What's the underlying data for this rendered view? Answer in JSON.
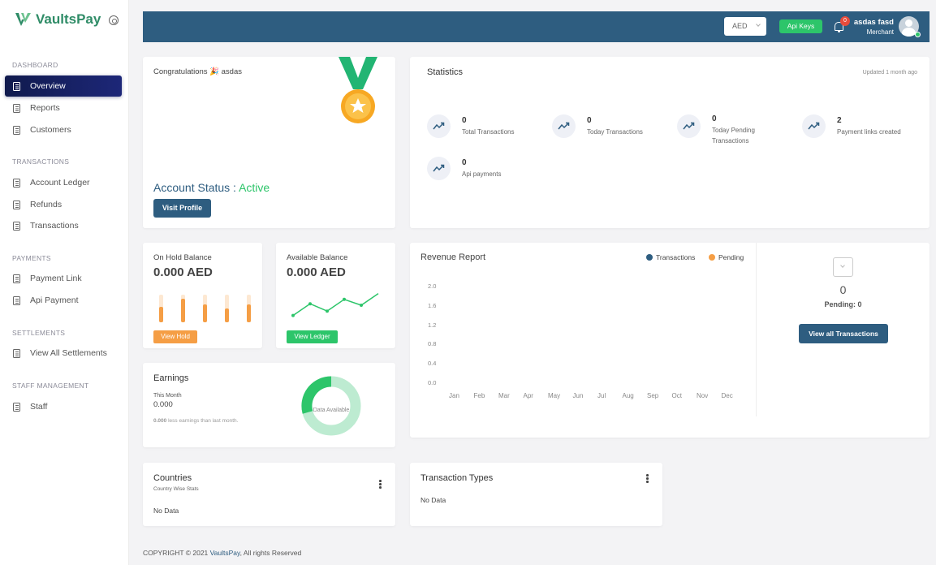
{
  "sidebar": {
    "logo_text": "VaultsPay",
    "sections": [
      {
        "title": "DASHBOARD",
        "items": [
          "Overview",
          "Reports",
          "Customers"
        ]
      },
      {
        "title": "TRANSACTIONS",
        "items": [
          "Account Ledger",
          "Refunds",
          "Transactions"
        ]
      },
      {
        "title": "PAYMENTS",
        "items": [
          "Payment Link",
          "Api Payment"
        ]
      },
      {
        "title": "SETTLEMENTS",
        "items": [
          "View All Settlements"
        ]
      },
      {
        "title": "STAFF MANAGEMENT",
        "items": [
          "Staff"
        ]
      }
    ],
    "active_item": "Overview"
  },
  "header": {
    "currency": "AED",
    "api_keys_label": "Api Keys",
    "notification_count": "0",
    "user_name": "asdas fasd",
    "user_role": "Merchant"
  },
  "welcome": {
    "greeting": "Congratulations 🎉 asdas",
    "status_label": "Account Status : ",
    "status_value": "Active",
    "visit_profile_label": "Visit Profile"
  },
  "statistics": {
    "title": "Statistics",
    "updated": "Updated 1 month ago",
    "items": [
      {
        "value": "0",
        "label_lines": [
          "Total Transactions"
        ]
      },
      {
        "value": "0",
        "label_lines": [
          "Today Transactions"
        ]
      },
      {
        "value": "0",
        "label_lines": [
          "Today Pending",
          "Transactions"
        ]
      },
      {
        "value": "2",
        "label_lines": [
          "Payment links created"
        ]
      },
      {
        "value": "0",
        "label_lines": [
          "Api payments"
        ]
      }
    ]
  },
  "on_hold": {
    "title": "On Hold Balance",
    "amount": "0.000 AED",
    "button": "View Hold",
    "bar_fills": [
      0.55,
      0.85,
      0.65,
      0.5,
      0.65
    ]
  },
  "available": {
    "title": "Available Balance",
    "amount": "0.000 AED",
    "button": "View Ledger",
    "trend": [
      0.15,
      0.55,
      0.3,
      0.7,
      0.5,
      0.9
    ]
  },
  "earnings": {
    "title": "Earnings",
    "period": "This Month",
    "value": "0.000",
    "comparison_value": "0.000",
    "comparison_text": "less earnings than last month.",
    "donut_label": "Data Available"
  },
  "revenue": {
    "title": "Revenue Report",
    "legend": [
      {
        "name": "Transactions",
        "color": "#2e5d80"
      },
      {
        "name": "Pending",
        "color": "#f59e45"
      }
    ],
    "side_value": "0",
    "pending_label": "Pending: 0",
    "view_all_label": "View all Transactions"
  },
  "chart_data": {
    "type": "bar",
    "categories": [
      "Jan",
      "Feb",
      "Mar",
      "Apr",
      "May",
      "Jun",
      "Jul",
      "Aug",
      "Sep",
      "Oct",
      "Nov",
      "Dec"
    ],
    "series": [
      {
        "name": "Transactions",
        "values": [
          0,
          0,
          0,
          0,
          0,
          0,
          0,
          0,
          0,
          0,
          0,
          0
        ]
      },
      {
        "name": "Pending",
        "values": [
          0,
          0,
          0,
          0,
          0,
          0,
          0,
          0,
          0,
          0,
          0,
          0
        ]
      }
    ],
    "yticks": [
      "2.0",
      "1.6",
      "1.2",
      "0.8",
      "0.4",
      "0.0"
    ],
    "ylim": [
      0,
      2.0
    ],
    "title": "Revenue Report"
  },
  "countries": {
    "title": "Countries",
    "subtitle": "Country Wise Stats",
    "empty": "No Data"
  },
  "transaction_types": {
    "title": "Transaction Types",
    "empty": "No Data"
  },
  "footer": {
    "prefix": "COPYRIGHT © 2021 ",
    "brand": "VaultsPay",
    "suffix": ", All rights Reserved"
  }
}
